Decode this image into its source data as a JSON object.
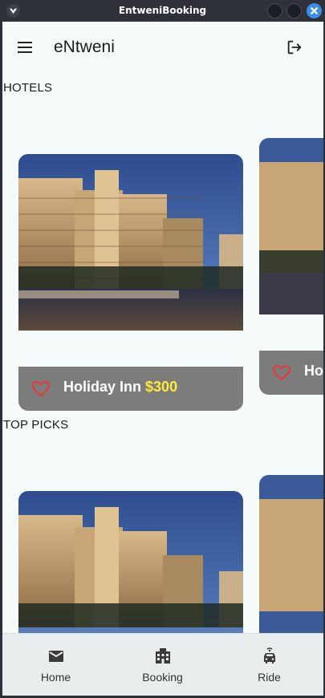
{
  "window": {
    "title": "EntweniBooking"
  },
  "appbar": {
    "title": "eNtweni"
  },
  "sections": {
    "hotels_label": "HOTELS",
    "top_picks_label": "TOP PICKS"
  },
  "hotels": [
    {
      "name": "Holiday Inn",
      "price": "$300"
    },
    {
      "name": "Ho",
      "price": ""
    }
  ],
  "bottom_nav": [
    {
      "label": "Home",
      "icon": "mail-icon"
    },
    {
      "label": "Booking",
      "icon": "hotel-building-icon"
    },
    {
      "label": "Ride",
      "icon": "taxi-icon"
    }
  ],
  "colors": {
    "caption_bg": "#7b7c7b",
    "price": "#ffeb3b",
    "heart": "#e53935",
    "close_button": "#3b8eea"
  }
}
